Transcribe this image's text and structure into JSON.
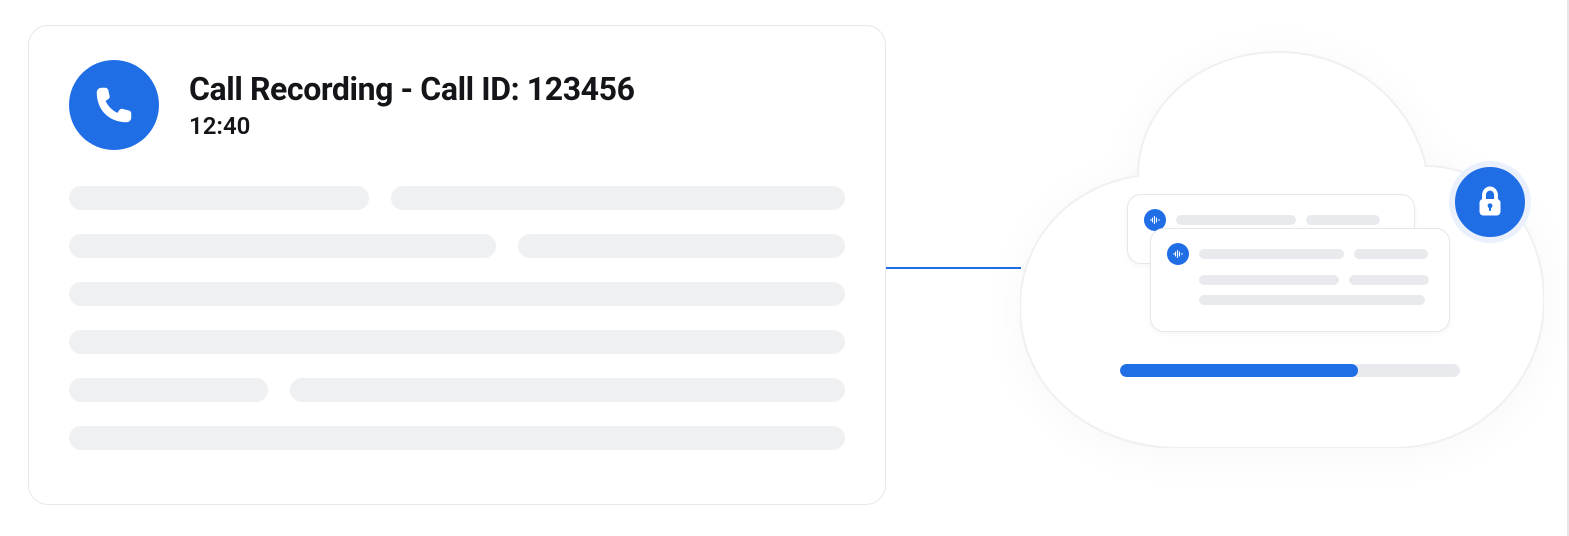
{
  "call_card": {
    "title": "Call Recording - Call ID: 123456",
    "duration": "12:40"
  },
  "cloud": {
    "progress_percent": 70,
    "secure": true
  },
  "colors": {
    "accent": "#1f6ee6",
    "skeleton": "#eef0f2",
    "border": "#e5e7eb"
  },
  "icons": {
    "phone": "phone-icon",
    "lock": "lock-icon",
    "audio": "audio-wave-icon"
  }
}
